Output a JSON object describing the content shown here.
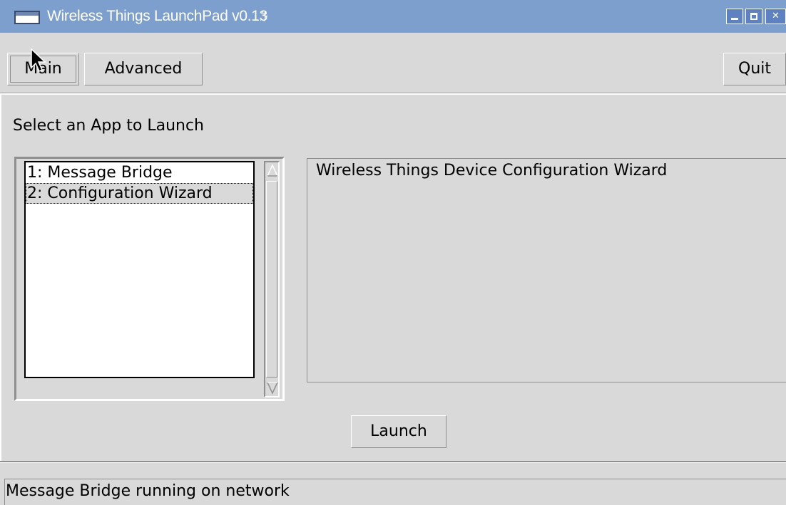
{
  "window": {
    "title": "Wireless Things LaunchPad v0.13",
    "title_glyph": "ꔓ",
    "controls": {
      "minimize": "minimize-icon",
      "maximize": "maximize-icon",
      "close": "close-icon"
    },
    "title_bar_color": "#7d9fce"
  },
  "tabs": [
    {
      "label": "Main",
      "active": true
    },
    {
      "label": "Advanced",
      "active": false
    }
  ],
  "quit_label": "Quit",
  "main": {
    "prompt": "Select an App to Launch",
    "apps": [
      {
        "label": "1: Message Bridge",
        "selected": false
      },
      {
        "label": "2: Configuration Wizard",
        "selected": true
      }
    ],
    "description": "Wireless Things Device Configuration Wizard",
    "launch_label": "Launch"
  },
  "status": {
    "text": "Message Bridge running on network"
  }
}
